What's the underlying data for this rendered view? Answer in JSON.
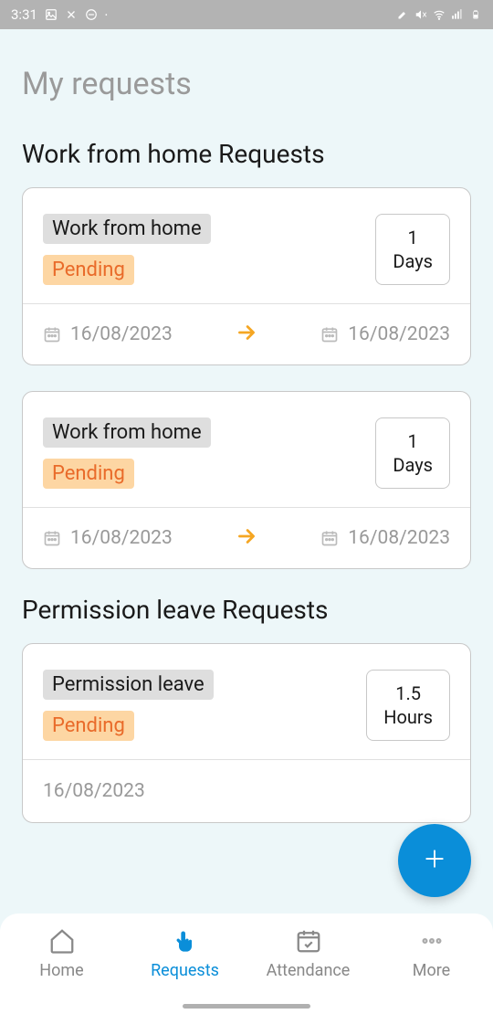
{
  "statusBar": {
    "time": "3:31"
  },
  "pageTitle": "My requests",
  "sections": [
    {
      "title": "Work from home Requests",
      "cards": [
        {
          "type": "Work from home",
          "status": "Pending",
          "durationValue": "1",
          "durationUnit": "Days",
          "startDate": "16/08/2023",
          "endDate": "16/08/2023",
          "showRange": true
        },
        {
          "type": "Work from home",
          "status": "Pending",
          "durationValue": "1",
          "durationUnit": "Days",
          "startDate": "16/08/2023",
          "endDate": "16/08/2023",
          "showRange": true
        }
      ]
    },
    {
      "title": "Permission leave Requests",
      "cards": [
        {
          "type": "Permission leave",
          "status": "Pending",
          "durationValue": "1.5",
          "durationUnit": "Hours",
          "startDate": "16/08/2023",
          "showRange": false
        }
      ]
    }
  ],
  "nav": {
    "home": "Home",
    "requests": "Requests",
    "attendance": "Attendance",
    "more": "More"
  }
}
